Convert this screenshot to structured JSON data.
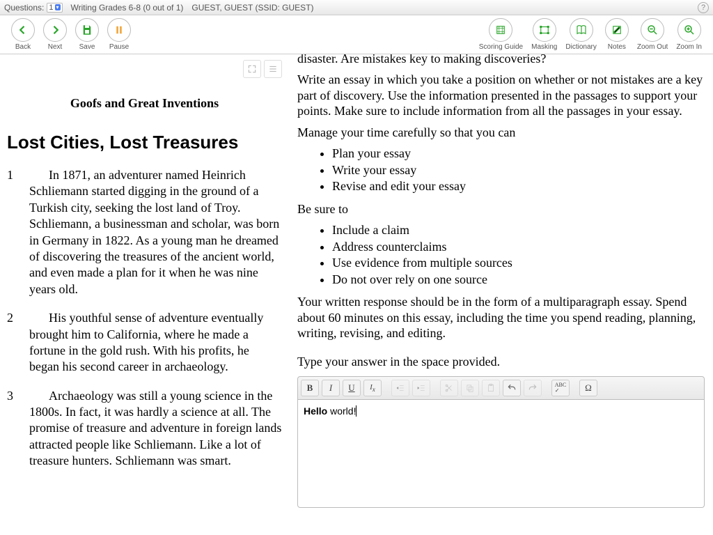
{
  "topbar": {
    "questions_label": "Questions:",
    "question_num": "1",
    "title": "Writing Grades 6-8 (0 out of 1)",
    "user": "GUEST, GUEST (SSID: GUEST)"
  },
  "toolbar": {
    "back": "Back",
    "next": "Next",
    "save": "Save",
    "pause": "Pause",
    "scoring": "Scoring Guide",
    "masking": "Masking",
    "dictionary": "Dictionary",
    "notes": "Notes",
    "zoomout": "Zoom Out",
    "zoomin": "Zoom In"
  },
  "passage": {
    "heading1": "Goofs and Great Inventions",
    "heading2": "Lost Cities, Lost Treasures",
    "paras": [
      "In 1871, an adventurer named Heinrich Schliemann started digging in the ground of a Turkish city, seeking the lost land of Troy. Schliemann, a businessman and scholar, was born in Germany in 1822. As a young man he dreamed of discovering the treasures of the ancient world, and even made a plan for it when he was nine years old.",
      "His youthful sense of adventure eventually brought him to California, where he made a fortune in the gold rush. With his profits, he began his second career in archaeology.",
      "Archaeology was still a young science in the 1800s. In fact, it was hardly a science at all. The promise of treasure and adventure in foreign lands attracted people like Schliemann. Like a lot of treasure hunters. Schliemann was smart."
    ]
  },
  "prompt": {
    "cut": "disaster. Are mistakes key to making discoveries?",
    "intro": "Write an essay in which you take a position on whether or not mistakes are a key part of discovery. Use the information presented in the passages to support your points. Make sure to include information from all the passages in your essay.",
    "manage": "Manage your time carefully so that you can",
    "manage_items": [
      "Plan your essay",
      "Write your essay",
      "Revise and edit your essay"
    ],
    "besure": "Be sure to",
    "besure_items": [
      "Include a claim",
      "Address counterclaims",
      "Use evidence from multiple sources",
      "Do not over rely on one source"
    ],
    "written": "Your written response should be in the form of a multiparagraph essay. Spend about 60 minutes on this essay, including the time you spend reading, planning, writing, revising, and editing.",
    "type": "Type your answer in the space provided."
  },
  "editor": {
    "bold": "B",
    "italic": "I",
    "underline": "U",
    "clear": "Tx",
    "omega": "Ω",
    "spell": "ABC",
    "content_bold": "Hello",
    "content_rest": " world!"
  }
}
